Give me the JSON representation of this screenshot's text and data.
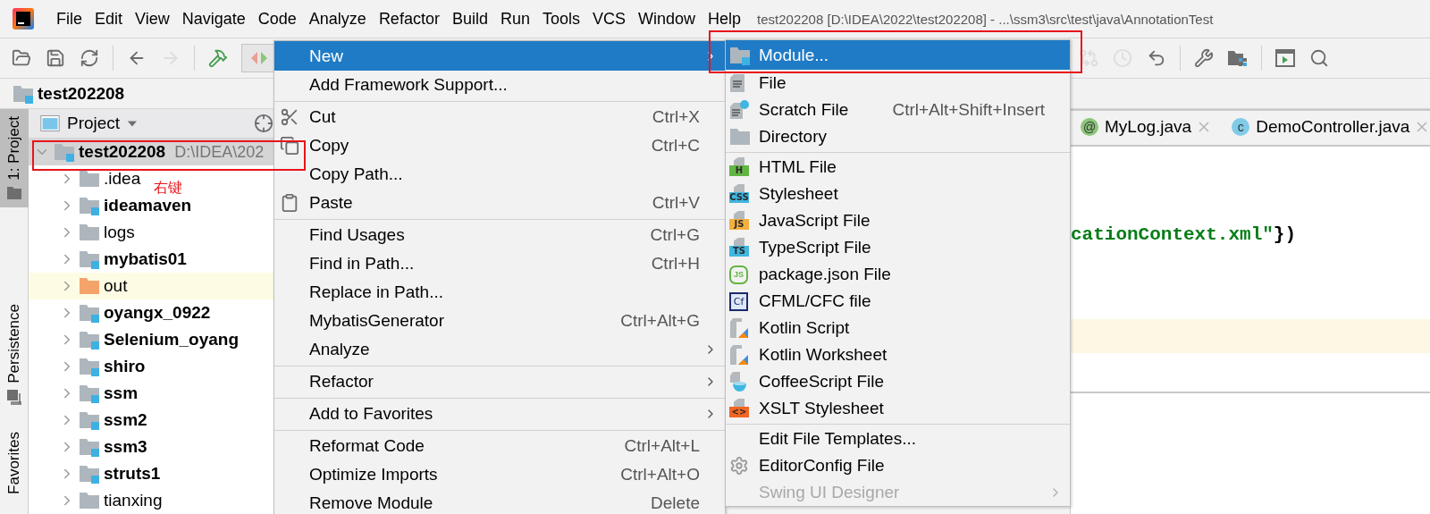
{
  "menu_bar": {
    "items": [
      "File",
      "Edit",
      "View",
      "Navigate",
      "Code",
      "Analyze",
      "Refactor",
      "Build",
      "Run",
      "Tools",
      "VCS",
      "Window",
      "Help"
    ],
    "title": "test202208 [D:\\IDEA\\2022\\test202208] - ...\\ssm3\\src\\test\\java\\AnnotationTest"
  },
  "toolbar_left": [
    {
      "kind": "open",
      "disabled": false
    },
    {
      "kind": "save",
      "disabled": false
    },
    {
      "kind": "sync",
      "disabled": false
    },
    {
      "kind": "separator"
    },
    {
      "kind": "back",
      "disabled": false
    },
    {
      "kind": "forward",
      "disabled": true
    },
    {
      "kind": "separator"
    },
    {
      "kind": "build",
      "disabled": false
    },
    {
      "kind": "run_config",
      "disabled": false
    }
  ],
  "toolbar_right": [
    {
      "kind": "vcs",
      "disabled": true
    },
    {
      "kind": "history",
      "disabled": true
    },
    {
      "kind": "undo",
      "disabled": false
    },
    {
      "kind": "separator"
    },
    {
      "kind": "settings",
      "disabled": false
    },
    {
      "kind": "structure",
      "disabled": false
    },
    {
      "kind": "separator"
    },
    {
      "kind": "terminal",
      "disabled": false
    },
    {
      "kind": "search",
      "disabled": false
    }
  ],
  "nav_bar": {
    "crumb": "test202208"
  },
  "tool_strip": [
    {
      "label": "1: Project",
      "selected": true
    },
    {
      "label": "Persistence",
      "selected": false
    },
    {
      "label": "Favorites",
      "selected": false
    }
  ],
  "project_panel": {
    "title": "Project",
    "root": {
      "label": "test202208",
      "path": "D:\\IDEA\\202",
      "kind": "module",
      "selected": true,
      "expanded": true,
      "children": [
        {
          "label": ".idea",
          "kind": "folder",
          "selected": false,
          "expanded": false
        },
        {
          "label": "ideamaven",
          "kind": "module",
          "selected": false,
          "expanded": false
        },
        {
          "label": "logs",
          "kind": "folder",
          "selected": false,
          "expanded": false
        },
        {
          "label": "mybatis01",
          "kind": "module",
          "selected": false,
          "expanded": false
        },
        {
          "label": "out",
          "kind": "excluded",
          "selected": false,
          "expanded": false
        },
        {
          "label": "oyangx_0922",
          "kind": "module",
          "selected": false,
          "expanded": false
        },
        {
          "label": "Selenium_oyang",
          "kind": "module",
          "selected": false,
          "expanded": false
        },
        {
          "label": "shiro",
          "kind": "module",
          "selected": false,
          "expanded": false
        },
        {
          "label": "ssm",
          "kind": "module",
          "selected": false,
          "expanded": false
        },
        {
          "label": "ssm2",
          "kind": "module",
          "selected": false,
          "expanded": false
        },
        {
          "label": "ssm3",
          "kind": "module",
          "selected": false,
          "expanded": false
        },
        {
          "label": "struts1",
          "kind": "module",
          "selected": false,
          "expanded": false
        },
        {
          "label": "tianxing",
          "kind": "folder",
          "selected": false,
          "expanded": false
        }
      ]
    }
  },
  "annotation": "右键",
  "editor": {
    "tabs": [
      {
        "label": "MyLog.java",
        "glyph": "@",
        "color": "#8cc67a",
        "selected": false
      },
      {
        "label": "DemoController.java",
        "glyph": "c",
        "color": "#80cce8",
        "selected": false
      }
    ],
    "code": [
      {
        "kind": "string",
        "text": "cationContext.xml\""
      },
      {
        "kind": "plain",
        "text": "})"
      }
    ],
    "current_line": true
  },
  "context_menu": {
    "groups": [
      {
        "items": [
          {
            "label": "New",
            "kind": "plain",
            "selected": true,
            "has_submenu": true
          },
          {
            "label": "Add Framework Support...",
            "kind": "plain",
            "selected": false,
            "has_submenu": false
          }
        ]
      },
      {
        "items": [
          {
            "label": "Cut",
            "shortcut": "Ctrl+X",
            "kind": "cut",
            "selected": false,
            "has_submenu": false
          },
          {
            "label": "Copy",
            "shortcut": "Ctrl+C",
            "kind": "copy",
            "selected": false,
            "has_submenu": false
          },
          {
            "label": "Copy Path...",
            "kind": "plain",
            "selected": false,
            "has_submenu": false
          },
          {
            "label": "Paste",
            "shortcut": "Ctrl+V",
            "kind": "paste",
            "selected": false,
            "has_submenu": false
          }
        ]
      },
      {
        "items": [
          {
            "label": "Find Usages",
            "shortcut": "Ctrl+G",
            "kind": "plain",
            "selected": false,
            "has_submenu": false
          },
          {
            "label": "Find in Path...",
            "shortcut": "Ctrl+H",
            "kind": "plain",
            "selected": false,
            "has_submenu": false
          },
          {
            "label": "Replace in Path...",
            "kind": "plain",
            "selected": false,
            "has_submenu": false
          },
          {
            "label": "MybatisGenerator",
            "shortcut": "Ctrl+Alt+G",
            "kind": "plain",
            "selected": false,
            "has_submenu": false
          },
          {
            "label": "Analyze",
            "kind": "plain",
            "selected": false,
            "has_submenu": true
          }
        ]
      },
      {
        "items": [
          {
            "label": "Refactor",
            "kind": "plain",
            "selected": false,
            "has_submenu": true
          }
        ]
      },
      {
        "items": [
          {
            "label": "Add to Favorites",
            "kind": "plain",
            "selected": false,
            "has_submenu": true
          }
        ]
      },
      {
        "items": [
          {
            "label": "Reformat Code",
            "shortcut": "Ctrl+Alt+L",
            "kind": "plain",
            "selected": false,
            "has_submenu": false
          },
          {
            "label": "Optimize Imports",
            "shortcut": "Ctrl+Alt+O",
            "kind": "plain",
            "selected": false,
            "has_submenu": false
          },
          {
            "label": "Remove Module",
            "shortcut": "Delete",
            "kind": "plain",
            "selected": false,
            "has_submenu": false
          }
        ]
      }
    ]
  },
  "new_submenu": {
    "groups": [
      {
        "items": [
          {
            "label": "Module...",
            "kind": "module",
            "selected": true,
            "disabled": false,
            "has_submenu": false
          },
          {
            "label": "File",
            "kind": "file",
            "selected": false,
            "disabled": false,
            "has_submenu": false
          },
          {
            "label": "Scratch File",
            "shortcut": "Ctrl+Alt+Shift+Insert",
            "kind": "scratch",
            "selected": false,
            "disabled": false,
            "has_submenu": false
          },
          {
            "label": "Directory",
            "kind": "folder",
            "selected": false,
            "disabled": false,
            "has_submenu": false
          }
        ]
      },
      {
        "items": [
          {
            "label": "HTML File",
            "kind": "badge",
            "badge": "H",
            "color": "#62b543",
            "selected": false,
            "disabled": false,
            "has_submenu": false
          },
          {
            "label": "Stylesheet",
            "kind": "badge",
            "badge": "CSS",
            "color": "#40b6e0",
            "selected": false,
            "disabled": false,
            "has_submenu": false
          },
          {
            "label": "JavaScript File",
            "kind": "badge",
            "badge": "JS",
            "color": "#f4af3d",
            "selected": false,
            "disabled": false,
            "has_submenu": false
          },
          {
            "label": "TypeScript File",
            "kind": "badge",
            "badge": "TS",
            "color": "#40b6e0",
            "selected": false,
            "disabled": false,
            "has_submenu": false
          },
          {
            "label": "package.json File",
            "kind": "hexagon",
            "badge": "JS",
            "color": "#62b543",
            "selected": false,
            "disabled": false,
            "has_submenu": false
          },
          {
            "label": "CFML/CFC file",
            "kind": "boxed",
            "badge": "Cf",
            "color": "#1c2a6e",
            "selected": false,
            "disabled": false,
            "has_submenu": false
          },
          {
            "label": "Kotlin Script",
            "kind": "kotlin",
            "selected": false,
            "disabled": false,
            "has_submenu": false
          },
          {
            "label": "Kotlin Worksheet",
            "kind": "kotlin",
            "selected": false,
            "disabled": false,
            "has_submenu": false
          },
          {
            "label": "CoffeeScript File",
            "kind": "coffee",
            "selected": false,
            "disabled": false,
            "has_submenu": false
          },
          {
            "label": "XSLT Stylesheet",
            "kind": "badge",
            "badge": "<>",
            "color": "#f26522",
            "selected": false,
            "disabled": false,
            "has_submenu": false
          }
        ]
      },
      {
        "items": [
          {
            "label": "Edit File Templates...",
            "kind": "plain",
            "selected": false,
            "disabled": false,
            "has_submenu": false
          },
          {
            "label": "EditorConfig File",
            "kind": "gear",
            "selected": false,
            "disabled": false,
            "has_submenu": false
          },
          {
            "label": "Swing UI Designer",
            "kind": "plain",
            "selected": false,
            "disabled": true,
            "has_submenu": true
          }
        ]
      }
    ]
  }
}
